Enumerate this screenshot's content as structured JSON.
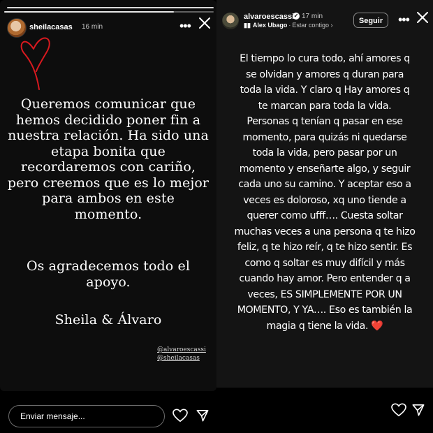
{
  "left_story": {
    "username": "sheilacasas",
    "time": "16 min",
    "message_lines": [
      "Queremos comunicar que",
      "hemos decidido poner fin a",
      "nuestra relación. Ha sido una",
      "etapa bonita que",
      "recordaremos con cariño,",
      "pero creemos que es lo mejor",
      "para ambos en este",
      "momento."
    ],
    "thanks_lines": [
      "Os agradecemos todo el",
      "apoyo."
    ],
    "signature": "Sheila & Álvaro",
    "mentions": [
      "@alvaroescassi",
      "@sheilacasas"
    ],
    "message_placeholder": "Enviar mensaje..."
  },
  "right_story": {
    "username": "alvaroescassi",
    "time": "17 min",
    "music_artist": "Alex Ubago",
    "music_status": "Estar contigo",
    "follow_label": "Seguir",
    "text_lines": [
      "El tiempo lo cura todo, ahí amores q",
      "se olvidan y amores q duran para",
      "toda la vida. Y claro q Hay amores q",
      "te marcan para toda la vida.",
      "Personas q tenían q pasar en ese",
      "momento, para quizás ni quedarse",
      "toda la vida, pero pasar por un",
      "momento y enseñarte algo, y seguir",
      "cada uno su camino. Y aceptar eso a",
      "veces es doloroso, xq uno tiende a",
      "querer como ufff…. Cuesta soltar",
      "muchas veces a una persona q te hizo",
      "feliz, q te hizo reír, q te hizo sentir. Es",
      "como q soltar es muy difícil y más",
      "cuando hay amor. Pero entender q a",
      "veces, ES SIMPLEMENTE POR UN",
      "MOMENTO, Y YA…. Eso es también la",
      "magia q tiene la vida."
    ],
    "heart_emoji": "❤️"
  },
  "icons": {
    "more": "more-options-icon",
    "close": "close-icon",
    "heart": "heart-icon",
    "send": "send-icon",
    "verified": "verified-badge-icon",
    "music": "music-bars-icon"
  },
  "colors": {
    "story_bg_left": "#0d0d0d",
    "story_bg_right": "#141414",
    "heart_red": "#e3141b",
    "doodle_red": "#d8191f"
  }
}
